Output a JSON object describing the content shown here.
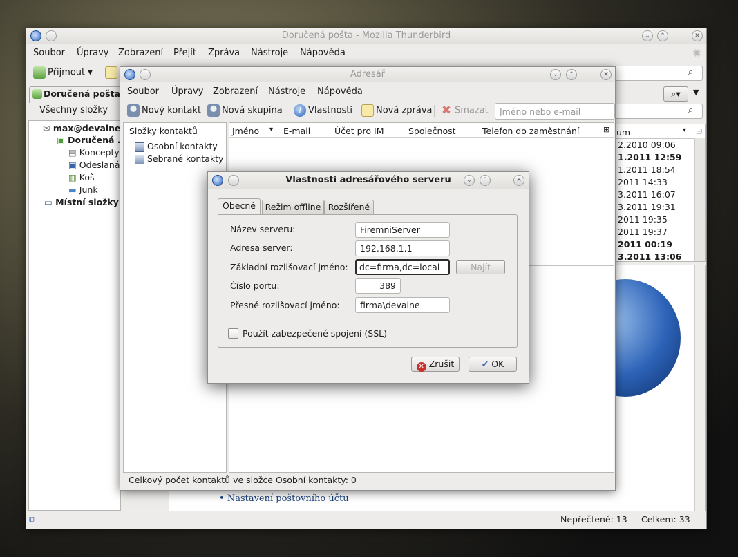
{
  "main_window": {
    "title": "Doručená pošta - Mozilla Thunderbird",
    "menu": [
      "Soubor",
      "Úpravy",
      "Zobrazení",
      "Přejít",
      "Zpráva",
      "Nástroje",
      "Nápověda"
    ],
    "get_mail": "Přijmout",
    "tab": "Doručená pošta",
    "folder_filter": "Všechny složky",
    "account": "max@devaine",
    "folders": [
      "Doručená ...",
      "Koncepty",
      "Odeslaná",
      "Koš",
      "Junk"
    ],
    "local_folders": "Místní složky",
    "date_column": "um",
    "dates": [
      "2.2010 09:06",
      "1.2011 12:59",
      "1.2011 18:54",
      "2011 14:33",
      "3.2011 16:07",
      "3.2011 19:31",
      "2011 19:35",
      "2011 19:37",
      "2011 00:19",
      "3.2011 13:06"
    ],
    "setup_link": "Nastavení poštovního účtu",
    "status_unread": "Nepřečtené: 13",
    "status_total": "Celkem: 33"
  },
  "addressbook": {
    "title": "Adresář",
    "menu": [
      "Soubor",
      "Úpravy",
      "Zobrazení",
      "Nástroje",
      "Nápověda"
    ],
    "toolbar": {
      "new_contact": "Nový kontakt",
      "new_group": "Nová skupina",
      "properties": "Vlastnosti",
      "new_message": "Nová zpráva",
      "delete": "Smazat",
      "search_placeholder": "Jméno nebo e-mail"
    },
    "folders_header": "Složky kontaktů",
    "books": [
      "Osobní kontakty",
      "Sebrané kontakty"
    ],
    "columns": [
      "Jméno",
      "E-mail",
      "Účet pro IM",
      "Společnost",
      "Telefon do zaměstnání"
    ],
    "status": "Celkový počet kontaktů ve složce Osobní kontakty: 0"
  },
  "dialog": {
    "title": "Vlastnosti adresářového serveru",
    "tabs": [
      "Obecné",
      "Režim offline",
      "Rozšířené"
    ],
    "fields": {
      "server_name_label": "Název serveru:",
      "server_name_value": "FiremniServer",
      "address_label": "Adresa server:",
      "address_value": "192.168.1.1",
      "base_dn_label": "Základní rozlišovací jméno:",
      "base_dn_value": "dc=firma,dc=local",
      "find_button": "Najít",
      "port_label": "Číslo portu:",
      "port_value": "389",
      "bind_dn_label": "Přesné rozlišovací jméno:",
      "bind_dn_value": "firma\\devaine"
    },
    "ssl_label": "Použít zabezpečené spojení (SSL)",
    "ssl_checked": false,
    "cancel_button": "Zrušit",
    "ok_button": "OK"
  }
}
